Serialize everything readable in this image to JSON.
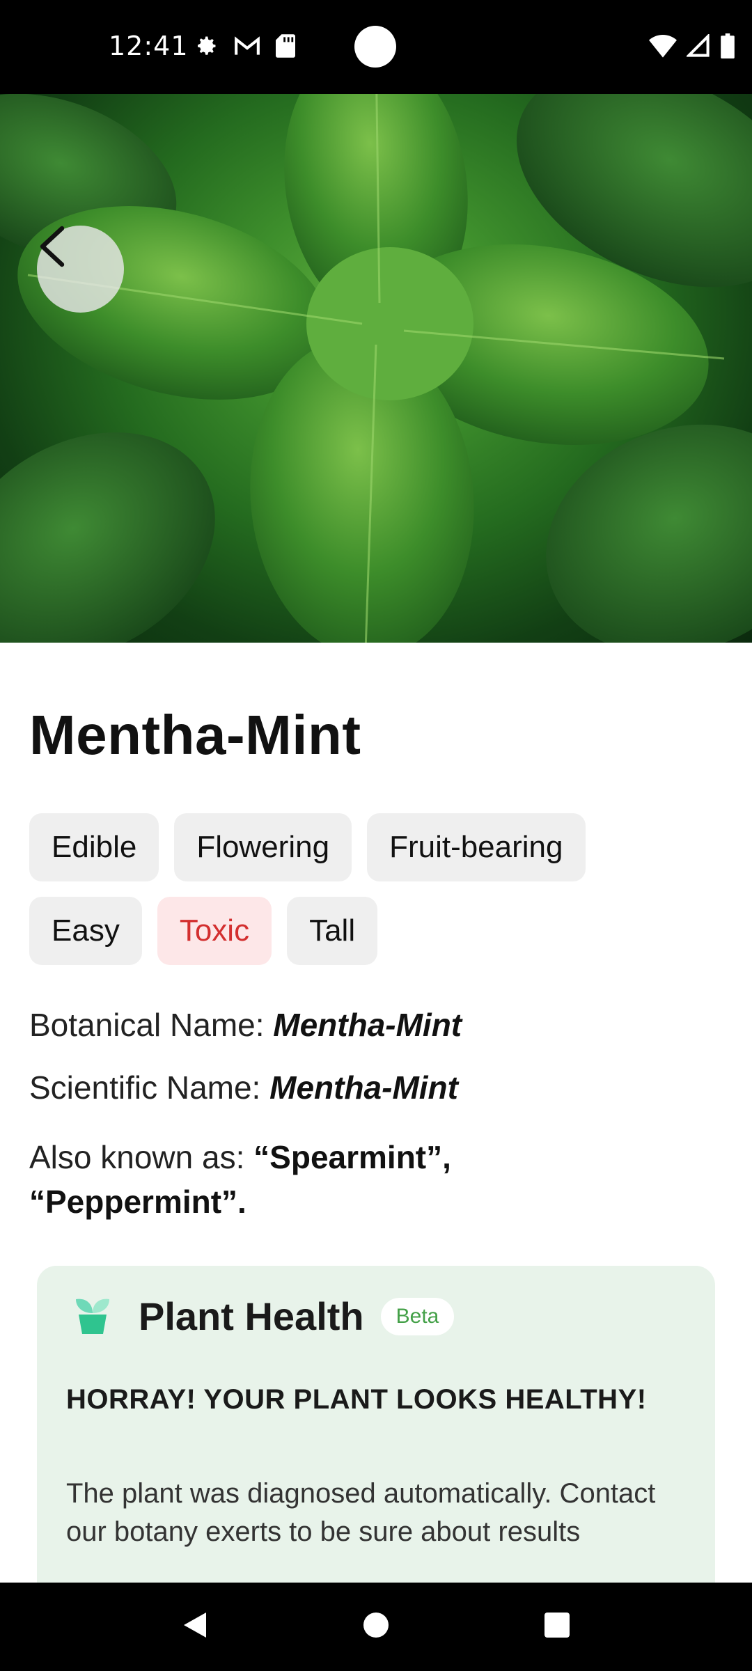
{
  "status_bar": {
    "time": "12:41",
    "left_icons": [
      "gear-icon",
      "gmail-icon",
      "sd-card-icon"
    ],
    "right_icons": [
      "wifi-icon",
      "signal-icon",
      "battery-icon"
    ]
  },
  "plant": {
    "name": "Mentha-Mint",
    "tags_row1": [
      "Edible",
      "Flowering",
      "Fruit-bearing"
    ],
    "tags_row2": [
      "Easy",
      "Toxic",
      "Tall"
    ],
    "botanical_label": "Botanical Name: ",
    "botanical_value": "Mentha-Mint",
    "scientific_label": "Scientific Name: ",
    "scientific_value": "Mentha-Mint",
    "aka_label": "Also known as:  ",
    "aka_value": "“Spearmint”, “Peppermint”."
  },
  "health": {
    "title": "Plant Health",
    "badge": "Beta",
    "headline": "HORRAY! YOUR PLANT LOOKS HEALTHY!",
    "description": "The plant was diagnosed automatically. Contact our botany exerts to be sure about results"
  },
  "colors": {
    "toxic_text": "#d32f2f",
    "toxic_bg": "#fde7e8",
    "card_bg": "#e8f3ea",
    "badge_text": "#43a047"
  }
}
